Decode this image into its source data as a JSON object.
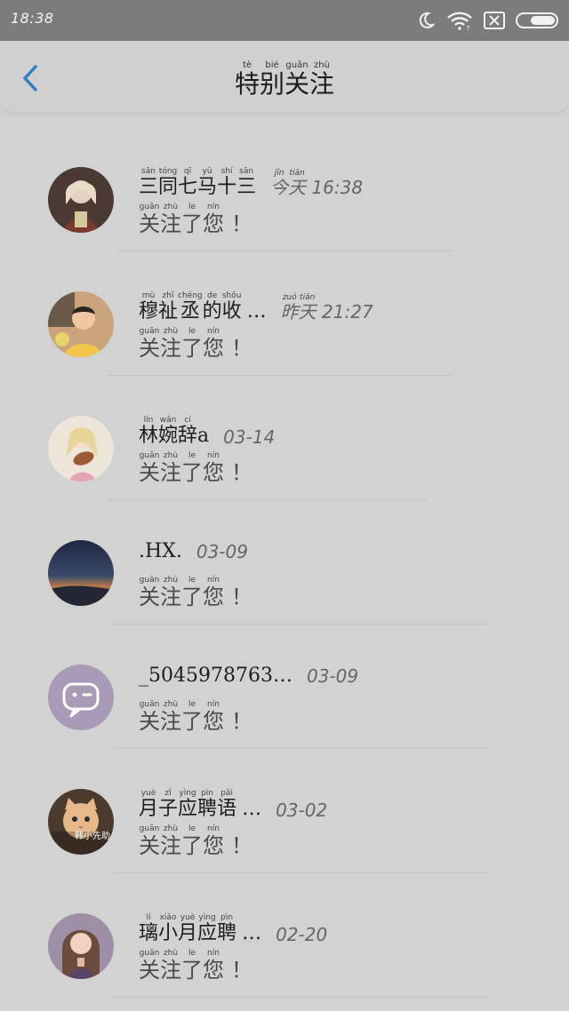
{
  "status_bar": {
    "time": "18:38",
    "icons": [
      "moon-icon",
      "wifi-icon",
      "sim-off-icon",
      "battery-icon"
    ]
  },
  "header": {
    "title_chars": [
      "特",
      "别",
      "关",
      "注"
    ],
    "title_pinyin": [
      "tè",
      "bié",
      "guān",
      "zhù"
    ]
  },
  "colors": {
    "accent": "#2f7fc1",
    "background": "#d2d2d2",
    "status_bar": "#7c7c7c"
  },
  "message": {
    "chars": [
      "关",
      "注",
      "了",
      "您"
    ],
    "pinyin": [
      "guān",
      "zhù",
      "le",
      "nín"
    ],
    "punct": "！"
  },
  "items": [
    {
      "name_chars": [
        "三",
        "同",
        "七",
        "马",
        "十",
        "三"
      ],
      "name_pinyin": [
        "sān",
        "tóng",
        "qī",
        "yǔ",
        "shí",
        "sān"
      ],
      "name_plain": "",
      "date_prefix_chars": [
        "今",
        "天"
      ],
      "date_prefix_pinyin": [
        "jīn",
        "tiān"
      ],
      "date": "16:38",
      "avatar": "avatar-doll"
    },
    {
      "name_chars": [
        "穆",
        "祉",
        "丞",
        "的",
        "收"
      ],
      "name_pinyin": [
        "mù",
        "zhǐ",
        "chéng",
        "de",
        "shōu"
      ],
      "name_plain": "…",
      "date_prefix_chars": [
        "昨",
        "天"
      ],
      "date_prefix_pinyin": [
        "zuó",
        "tiān"
      ],
      "date": "21:27",
      "avatar": "avatar-boy"
    },
    {
      "name_chars": [
        "林",
        "婉",
        "辞"
      ],
      "name_pinyin": [
        "lín",
        "wǎn",
        "cí"
      ],
      "name_plain": "a",
      "date_prefix_chars": [],
      "date_prefix_pinyin": [],
      "date": "03-14",
      "avatar": "avatar-violin"
    },
    {
      "name_chars": [],
      "name_pinyin": [],
      "name_plain": ".HX.",
      "date_prefix_chars": [],
      "date_prefix_pinyin": [],
      "date": "03-09",
      "avatar": "avatar-sunset"
    },
    {
      "name_chars": [],
      "name_pinyin": [],
      "name_plain": "_5045978763…",
      "date_prefix_chars": [],
      "date_prefix_pinyin": [],
      "date": "03-09",
      "avatar": "avatar-default"
    },
    {
      "name_chars": [
        "月",
        "子",
        "应",
        "聘",
        "语"
      ],
      "name_pinyin": [
        "yuè",
        "zǐ",
        "yìng",
        "pìn",
        "pǎi"
      ],
      "name_plain": "…",
      "date_prefix_chars": [],
      "date_prefix_pinyin": [],
      "date": "03-02",
      "avatar": "avatar-cat",
      "avatar_caption": "韩小先助"
    },
    {
      "name_chars": [
        "璃",
        "小",
        "月",
        "应",
        "聘"
      ],
      "name_pinyin": [
        "lí",
        "xiǎo",
        "yuè",
        "yìng",
        "pìn"
      ],
      "name_plain": "…",
      "date_prefix_chars": [],
      "date_prefix_pinyin": [],
      "date": "02-20",
      "avatar": "avatar-girl"
    }
  ]
}
